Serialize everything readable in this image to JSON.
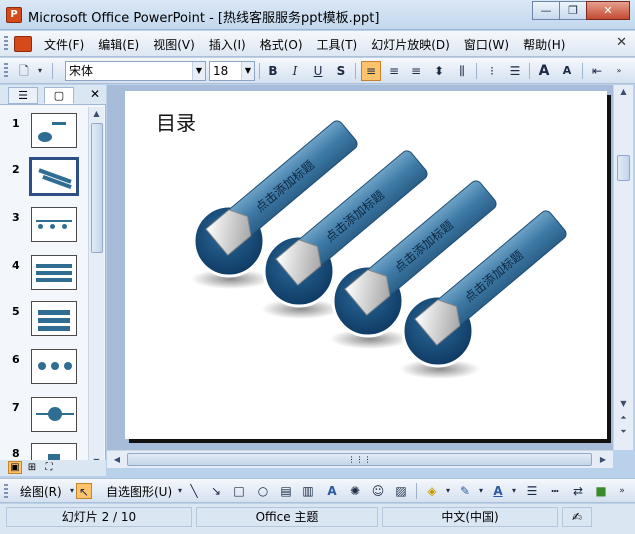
{
  "window": {
    "title": "Microsoft Office PowerPoint - [热线客服服务ppt模板.ppt]",
    "app_icon_letter": "P",
    "minimize": "—",
    "restore": "❐",
    "close": "✕"
  },
  "menu": {
    "items": [
      "文件(F)",
      "编辑(E)",
      "视图(V)",
      "插入(I)",
      "格式(O)",
      "工具(T)",
      "幻灯片放映(D)",
      "窗口(W)",
      "帮助(H)"
    ],
    "close": "✕"
  },
  "format_toolbar": {
    "font_name": "宋体",
    "font_size": "18",
    "bold": "B",
    "italic": "I",
    "underline": "U",
    "shadow": "S",
    "grow_font": "A",
    "shrink_font": "A"
  },
  "left_pane": {
    "tab_outline": "☰",
    "tab_slides": "▢",
    "close": "✕",
    "slide_numbers": [
      "1",
      "2",
      "3",
      "4",
      "5",
      "6",
      "7",
      "8"
    ],
    "selected_slide": "2"
  },
  "slide": {
    "title": "目录",
    "item_label": "点击添加标题",
    "accent_color": "#1b4f7a",
    "bar_color": "#3e7aa6"
  },
  "draw_toolbar": {
    "draw_menu": "绘图(R)",
    "autoshapes_menu": "自选图形(U)"
  },
  "status": {
    "slide_position": "幻灯片 2 / 10",
    "theme": "Office 主题",
    "language": "中文(中国)"
  }
}
